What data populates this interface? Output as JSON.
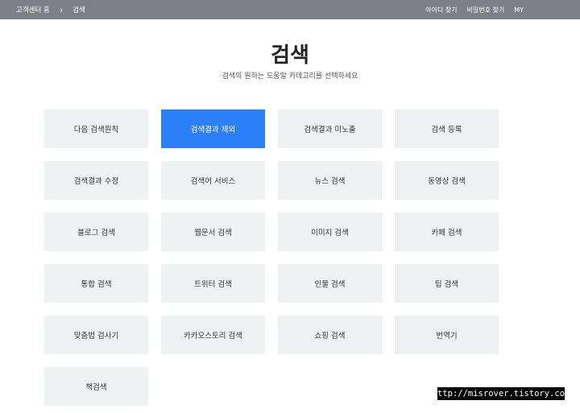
{
  "topbar": {
    "breadcrumb_home": "고객센터 홈",
    "breadcrumb_sep": "›",
    "breadcrumb_current": "검색",
    "links": [
      "아이디 찾기",
      "비밀번호 찾기",
      "MY"
    ]
  },
  "page": {
    "title": "검색",
    "subtitle": "검색의 원하는 도움말 카테고리를 선택하세요"
  },
  "categories": [
    "다음 검색원칙",
    "검색결과 제외",
    "검색결과 미노출",
    "검색 등록",
    "검색결과 수정",
    "검색어 서비스",
    "뉴스 검색",
    "동영상 검색",
    "블로그 검색",
    "웹문서 검색",
    "이미지 검색",
    "카페 검색",
    "통합 검색",
    "트위터 검색",
    "인물 검색",
    "팁 검색",
    "맞춤법 검사기",
    "카카오스토리 검색",
    "쇼핑 검색",
    "번역기",
    "책검색"
  ],
  "active_category": "검색결과 제외",
  "colors": {
    "topbar": "#7d8086",
    "tile": "#eff0f2",
    "active": "#2b80f7"
  },
  "watermark": "http://misrover.tistory.com"
}
